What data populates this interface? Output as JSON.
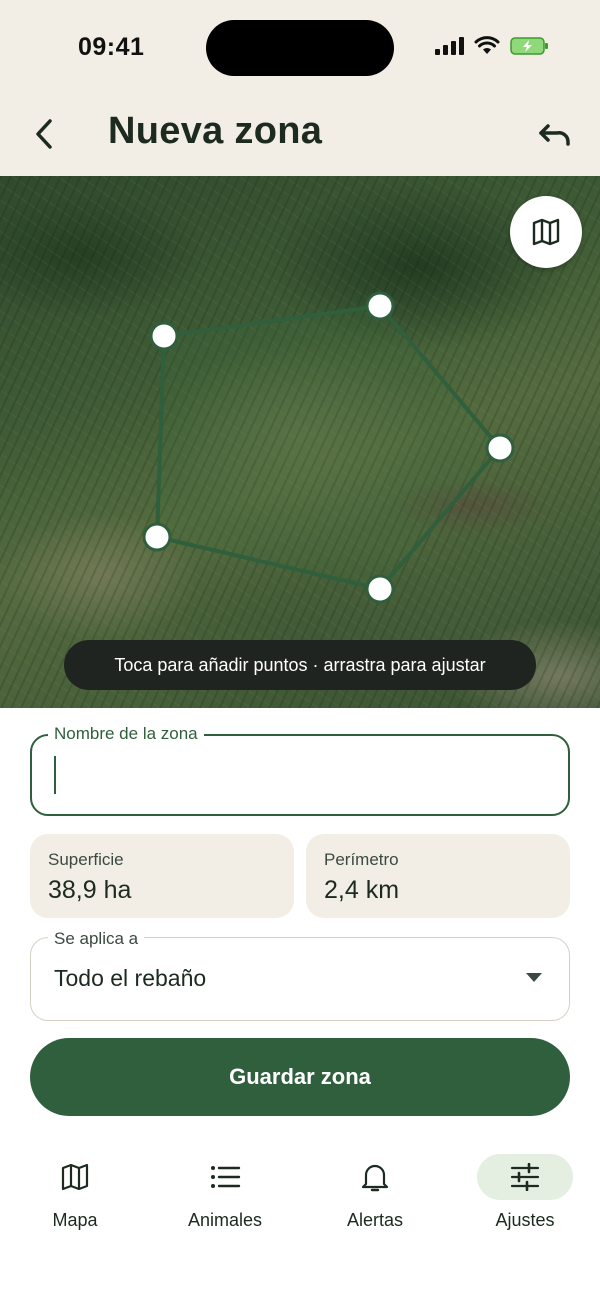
{
  "status_bar": {
    "time": "09:41"
  },
  "header": {
    "title": "Nueva zona"
  },
  "map": {
    "hint": "Toca para añadir puntos · arrastra para ajustar",
    "polygon_color": "#2f5f3c"
  },
  "form": {
    "name_label": "Nombre de la zona",
    "name_value": "",
    "surface_label": "Superficie",
    "surface_value": "38,9 ha",
    "perimeter_label": "Perímetro",
    "perimeter_value": "2,4 km",
    "applies_label": "Se aplica a",
    "applies_value": "Todo el rebaño",
    "save_label": "Guardar zona"
  },
  "nav": {
    "items": [
      {
        "label": "Mapa",
        "icon": "map-icon"
      },
      {
        "label": "Animales",
        "icon": "list-icon"
      },
      {
        "label": "Alertas",
        "icon": "bell-icon"
      },
      {
        "label": "Ajustes",
        "icon": "sliders-icon",
        "active": true
      }
    ]
  },
  "colors": {
    "accent": "#2f5f3c",
    "surface": "#f2eee5",
    "active_pill": "#e4efe2"
  }
}
